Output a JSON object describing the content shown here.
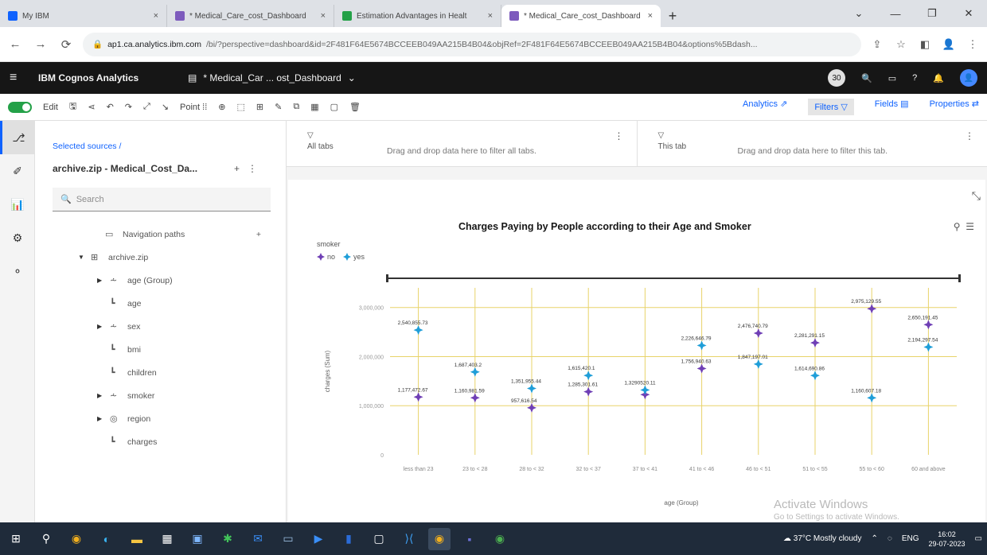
{
  "browser": {
    "tabs": [
      {
        "label": "My IBM",
        "favicon_color": "#0f62fe"
      },
      {
        "label": "* Medical_Care_cost_Dashboard",
        "favicon_color": "#7d5bbd"
      },
      {
        "label": "Estimation Advantages in Healt",
        "favicon_color": "#24a148"
      },
      {
        "label": "* Medical_Care_cost_Dashboard",
        "favicon_color": "#7d5bbd"
      }
    ],
    "active_tab": 3,
    "url_host": "ap1.ca.analytics.ibm.com",
    "url_rest": "/bi/?perspective=dashboard&id=2F481F64E5674BCCEEB049AA215B4B04&objRef=2F481F64E5674BCCEEB049AA215B4B04&options%5Bdash..."
  },
  "app": {
    "product": "IBM Cognos Analytics",
    "document": "* Medical_Car ... ost_Dashboard",
    "avatar_initials": "30"
  },
  "toolbar": {
    "edit_label": "Edit",
    "point_label": "Point",
    "analytics_label": "Analytics",
    "filters_label": "Filters",
    "fields_label": "Fields",
    "properties_label": "Properties"
  },
  "datapanel": {
    "breadcrumb": "Selected sources  /",
    "source_name": "archive.zip - Medical_Cost_Da...",
    "search_placeholder": "Search",
    "tree": [
      {
        "label": "Navigation paths",
        "twisty": "",
        "icon": "nav",
        "plus": "+"
      },
      {
        "label": "archive.zip",
        "twisty": "▼",
        "icon": "table"
      },
      {
        "label": "age (Group)",
        "twisty": "▶",
        "icon": "group"
      },
      {
        "label": "age",
        "twisty": "",
        "icon": "measure"
      },
      {
        "label": "sex",
        "twisty": "▶",
        "icon": "group"
      },
      {
        "label": "bmi",
        "twisty": "",
        "icon": "measure"
      },
      {
        "label": "children",
        "twisty": "",
        "icon": "measure"
      },
      {
        "label": "smoker",
        "twisty": "▶",
        "icon": "group"
      },
      {
        "label": "region",
        "twisty": "▶",
        "icon": "geo"
      },
      {
        "label": "charges",
        "twisty": "",
        "icon": "measure"
      }
    ]
  },
  "filters": {
    "all_tabs_label": "All tabs",
    "all_tabs_hint": "Drag and drop data here to filter all tabs.",
    "this_tab_label": "This tab",
    "this_tab_hint": "Drag and drop data here to filter this tab."
  },
  "watermark": {
    "title": "Activate Windows",
    "subtitle": "Go to Settings to activate Windows."
  },
  "taskbar": {
    "weather": "37°C  Mostly cloudy",
    "lang": "ENG",
    "time": "16:02",
    "date": "29-07-2023"
  },
  "colors": {
    "series_no": "#6f3fb5",
    "series_yes": "#1f9ed8",
    "grid": "#e8d36a",
    "accent": "#0f62fe"
  },
  "chart_data": {
    "type": "scatter",
    "title": "Charges Paying by People according to their Age and Smoker",
    "legend_title": "smoker",
    "xlabel": "age (Group)",
    "ylabel": "charges (Sum)",
    "categories": [
      "less than 23",
      "23 to < 28",
      "28 to < 32",
      "32 to < 37",
      "37 to < 41",
      "41 to < 46",
      "46 to < 51",
      "51 to < 55",
      "55 to < 60",
      "60 and above"
    ],
    "yticks": [
      0,
      1000000,
      2000000,
      3000000
    ],
    "ytick_labels": [
      "0",
      "1,000,000",
      "2,000,000",
      "3,000,000"
    ],
    "ylim": [
      0,
      3400000
    ],
    "grid": true,
    "legend_position": "top-left",
    "series": [
      {
        "name": "no",
        "values": [
          1177472.67,
          1160981.59,
          957616.54,
          1285301.61,
          1226000,
          1756940.63,
          2476740.79,
          2281291.15,
          2975129.55,
          2650191.45
        ],
        "labels": [
          "1,177,472.67",
          "1,160,981.59",
          "957,616.54",
          "1,285,301.61",
          "",
          "1,756,940.63",
          "2,476,740.79",
          "2,281,291.15",
          "2,975,129.55",
          "2,650,191.45"
        ]
      },
      {
        "name": "yes",
        "values": [
          2540855.73,
          1687403.2,
          1351955.44,
          1615420.1,
          1320000,
          2226646.79,
          1847197.01,
          1614690.86,
          1160607.18,
          2194297.54
        ],
        "labels": [
          "2,540,855.73",
          "1,687,403.2",
          "1,351,955.44",
          "1,615,420.1",
          "1,3290520.11",
          "2,226,646.79",
          "1,847,197.01",
          "1,614,690.86",
          "1,160,607.18",
          "2,194,297.54"
        ]
      }
    ]
  }
}
